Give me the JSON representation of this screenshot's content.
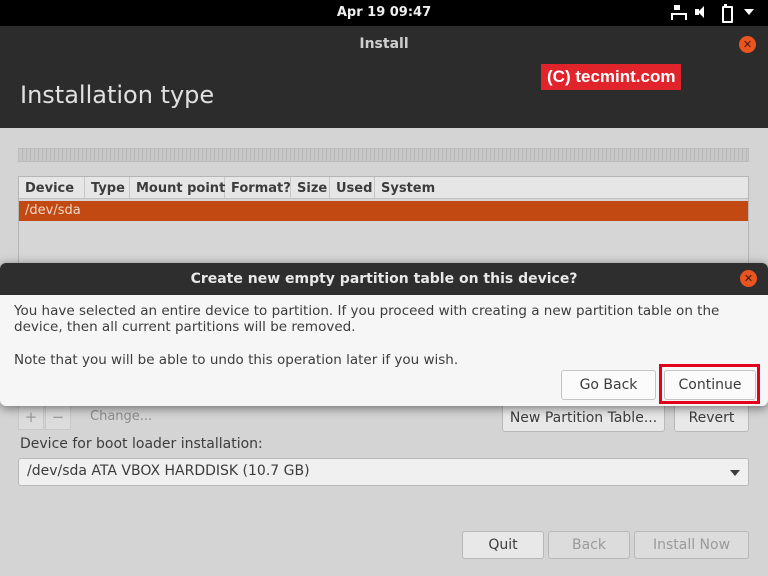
{
  "topbar": {
    "clock": "Apr 19  09:47",
    "icons": [
      "network-icon",
      "volume-icon",
      "battery-icon",
      "menu-arrow-icon"
    ]
  },
  "window": {
    "title": "Install",
    "heading": "Installation type",
    "watermark": "(C) tecmint.com"
  },
  "partition_table": {
    "columns": [
      "Device",
      "Type",
      "Mount point",
      "Format?",
      "Size",
      "Used",
      "System"
    ],
    "rows": [
      {
        "device": "/dev/sda"
      }
    ],
    "selected_color": "#c24a12"
  },
  "toolbar": {
    "add": "+",
    "remove": "−",
    "change": "Change...",
    "new_table": "New Partition Table...",
    "revert": "Revert"
  },
  "bootloader": {
    "label": "Device for boot loader installation:",
    "selected": "/dev/sda ATA VBOX HARDDISK (10.7 GB)"
  },
  "footer": {
    "quit": "Quit",
    "back": "Back",
    "install_now": "Install Now"
  },
  "dialog": {
    "title": "Create new empty partition table on this device?",
    "message": "You have selected an entire device to partition. If you proceed with creating a new partition table on the device, then all current partitions will be removed.",
    "note": "Note that you will be able to undo this operation later if you wish.",
    "go_back": "Go Back",
    "continue": "Continue"
  },
  "colors": {
    "accent": "#e95420",
    "highlight": "#e3001b"
  }
}
